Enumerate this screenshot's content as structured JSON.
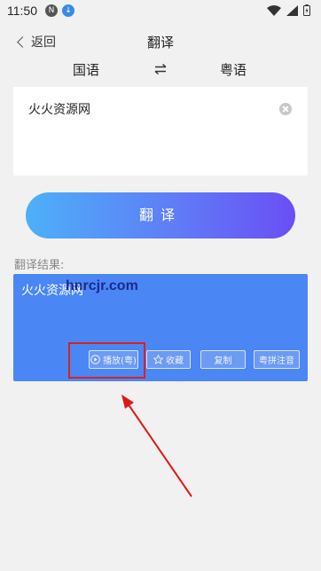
{
  "status_bar": {
    "time": "11:50",
    "notif_n": "N",
    "notif_d": "↓"
  },
  "header": {
    "back_label": "返回",
    "title": "翻译"
  },
  "languages": {
    "source": "国语",
    "target": "粤语"
  },
  "input": {
    "value": "火火资源网"
  },
  "translate_button": {
    "label": "翻译"
  },
  "result": {
    "label": "翻译结果:",
    "text": "火火资源网",
    "watermark": "hnrcjr.com",
    "actions": {
      "play": "播放(粤)",
      "favorite": "收藏",
      "copy": "复制",
      "pinyin": "粤拼注音"
    }
  },
  "colors": {
    "accent_start": "#4db0f8",
    "accent_end": "#6a4ef5",
    "result_bg": "#4a87f5",
    "highlight": "#d92020"
  }
}
